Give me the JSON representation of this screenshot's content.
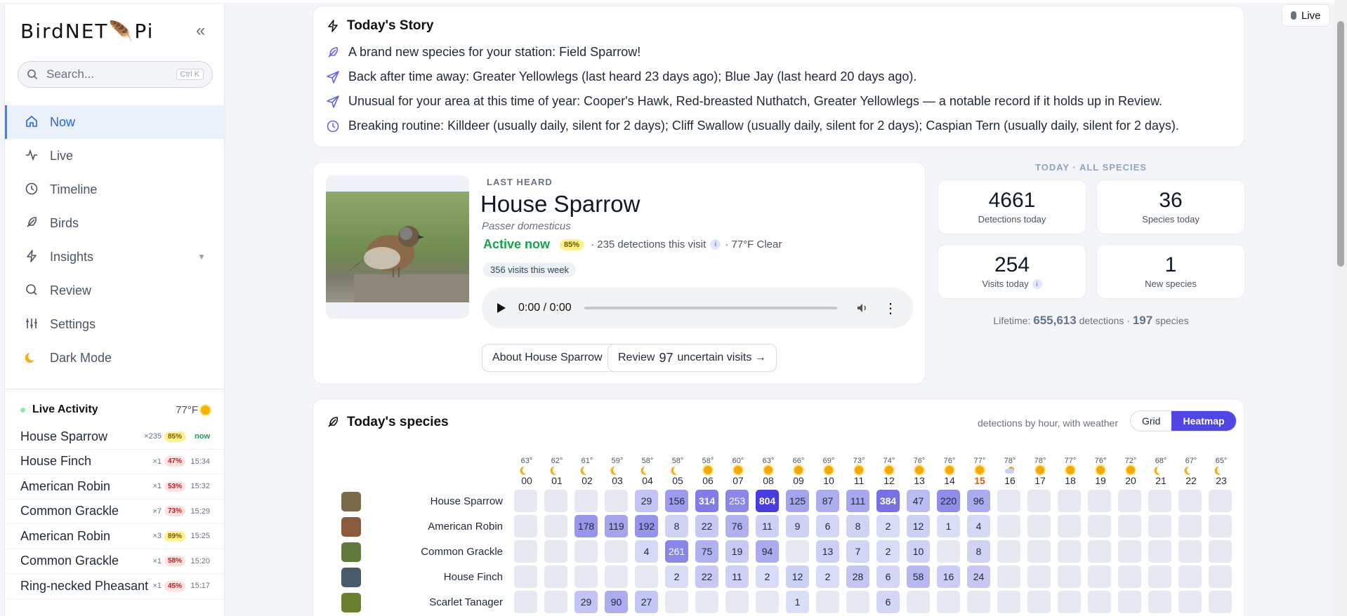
{
  "brand": {
    "left": "BirdNET",
    "right": "Pi"
  },
  "search": {
    "placeholder": "Search...",
    "shortcut": "Ctrl K"
  },
  "nav": [
    {
      "label": "Now",
      "icon": "home-icon",
      "active": true
    },
    {
      "label": "Live",
      "icon": "pulse-icon"
    },
    {
      "label": "Timeline",
      "icon": "clock-icon"
    },
    {
      "label": "Birds",
      "icon": "feather-icon"
    },
    {
      "label": "Insights",
      "icon": "bolt-icon",
      "caret": "▼"
    },
    {
      "label": "Review",
      "icon": "search-icon"
    },
    {
      "label": "Settings",
      "icon": "sliders-icon"
    },
    {
      "label": "Dark Mode",
      "icon": "moon-icon"
    }
  ],
  "live_activity": {
    "title": "Live Activity",
    "temp": "77°F",
    "items": [
      {
        "name": "House Sparrow",
        "count": "×235",
        "conf": "85%",
        "conf_color": "#fef08a",
        "conf_text": "#7a5d00",
        "time": "now"
      },
      {
        "name": "House Finch",
        "count": "×1",
        "conf": "47%",
        "conf_color": "#fee2e2",
        "conf_text": "#b91c1c",
        "time": "15:34"
      },
      {
        "name": "American Robin",
        "count": "×1",
        "conf": "53%",
        "conf_color": "#fee2e2",
        "conf_text": "#b91c1c",
        "time": "15:32"
      },
      {
        "name": "Common Grackle",
        "count": "×7",
        "conf": "73%",
        "conf_color": "#fee2e2",
        "conf_text": "#b91c1c",
        "time": "15:29"
      },
      {
        "name": "American Robin",
        "count": "×3",
        "conf": "89%",
        "conf_color": "#fef08a",
        "conf_text": "#7a5d00",
        "time": "15:25"
      },
      {
        "name": "Common Grackle",
        "count": "×1",
        "conf": "58%",
        "conf_color": "#fee2e2",
        "conf_text": "#b91c1c",
        "time": "15:20"
      },
      {
        "name": "Ring-necked Pheasant",
        "count": "×1",
        "conf": "45%",
        "conf_color": "#fee2e2",
        "conf_text": "#b91c1c",
        "time": "15:17"
      }
    ]
  },
  "story": {
    "title": "Today's Story",
    "lines": [
      {
        "icon": "feather-icon",
        "text": "A brand new species for your station: Field Sparrow!"
      },
      {
        "icon": "send-icon",
        "text": "Back after time away: Greater Yellowlegs (last heard 23 days ago); Blue Jay (last heard 20 days ago)."
      },
      {
        "icon": "send-icon",
        "text": "Unusual for your area at this time of year: Cooper's Hawk, Red-breasted Nuthatch, Greater Yellowlegs — a notable record if it holds up in Review."
      },
      {
        "icon": "clock-icon",
        "text": "Breaking routine: Killdeer (usually daily, silent for 2 days); Cliff Swallow (usually daily, silent for 2 days); Caspian Tern (usually daily, silent for 2 days)."
      }
    ]
  },
  "last_heard": {
    "label": "LAST HEARD",
    "name": "House Sparrow",
    "scientific": "Passer domesticus",
    "status": "Active now",
    "confidence": "85%",
    "detections": "· 235 detections this visit",
    "weather": "· 77°F Clear",
    "visits": "356 visits this week",
    "audio_time": "0:00 / 0:00",
    "about_button": "About House Sparrow →",
    "review_prefix": "Review",
    "review_count": "97",
    "review_suffix": "uncertain visits →"
  },
  "today": {
    "label": "TODAY · ALL SPECIES",
    "stats": [
      {
        "value": "4661",
        "label": "Detections today"
      },
      {
        "value": "36",
        "label": "Species today"
      },
      {
        "value": "254",
        "label": "Visits today",
        "info": true
      },
      {
        "value": "1",
        "label": "New species"
      }
    ],
    "lifetime_prefix": "Lifetime:",
    "lifetime_detections": "655,613",
    "lifetime_mid": "detections ·",
    "lifetime_species": "197",
    "lifetime_suffix": "species"
  },
  "species_card": {
    "title": "Today's species",
    "subtitle": "detections by hour, with weather",
    "toggle": [
      "Grid",
      "Heatmap"
    ],
    "active_toggle": "Heatmap",
    "current_hour": "15",
    "hours": [
      {
        "h": "00",
        "t": "63°",
        "w": "moon"
      },
      {
        "h": "01",
        "t": "62°",
        "w": "moon"
      },
      {
        "h": "02",
        "t": "61°",
        "w": "moon"
      },
      {
        "h": "03",
        "t": "59°",
        "w": "moon"
      },
      {
        "h": "04",
        "t": "58°",
        "w": "moon"
      },
      {
        "h": "05",
        "t": "58°",
        "w": "moon"
      },
      {
        "h": "06",
        "t": "58°",
        "w": "sun"
      },
      {
        "h": "07",
        "t": "60°",
        "w": "sun"
      },
      {
        "h": "08",
        "t": "63°",
        "w": "sun"
      },
      {
        "h": "09",
        "t": "66°",
        "w": "sun"
      },
      {
        "h": "10",
        "t": "69°",
        "w": "sun"
      },
      {
        "h": "11",
        "t": "73°",
        "w": "sun"
      },
      {
        "h": "12",
        "t": "74°",
        "w": "sun"
      },
      {
        "h": "13",
        "t": "76°",
        "w": "sun"
      },
      {
        "h": "14",
        "t": "76°",
        "w": "sun"
      },
      {
        "h": "15",
        "t": "77°",
        "w": "sun"
      },
      {
        "h": "16",
        "t": "78°",
        "w": "cloud"
      },
      {
        "h": "17",
        "t": "78°",
        "w": "sun"
      },
      {
        "h": "18",
        "t": "77°",
        "w": "sun"
      },
      {
        "h": "19",
        "t": "76°",
        "w": "sun"
      },
      {
        "h": "20",
        "t": "72°",
        "w": "sun"
      },
      {
        "h": "21",
        "t": "68°",
        "w": "moon"
      },
      {
        "h": "22",
        "t": "67°",
        "w": "moon"
      },
      {
        "h": "23",
        "t": "65°",
        "w": "moon"
      }
    ],
    "rows": [
      {
        "name": "House Sparrow",
        "thumb": "#7b6a4a",
        "values": [
          "",
          "",
          "",
          "",
          "29",
          "156",
          "314",
          "253",
          "804",
          "125",
          "87",
          "111",
          "384",
          "47",
          "220",
          "96",
          "",
          "",
          "",
          "",
          "",
          "",
          "",
          ""
        ]
      },
      {
        "name": "American Robin",
        "thumb": "#8a5a3c",
        "values": [
          "",
          "",
          "178",
          "119",
          "192",
          "8",
          "22",
          "76",
          "11",
          "9",
          "6",
          "8",
          "2",
          "12",
          "1",
          "4",
          "",
          "",
          "",
          "",
          "",
          "",
          "",
          ""
        ]
      },
      {
        "name": "Common Grackle",
        "thumb": "#5f7a3a",
        "values": [
          "",
          "",
          "",
          "",
          "4",
          "261",
          "75",
          "19",
          "94",
          "",
          "13",
          "7",
          "2",
          "10",
          "",
          "8",
          "",
          "",
          "",
          "",
          "",
          "",
          "",
          ""
        ]
      },
      {
        "name": "House Finch",
        "thumb": "#4a5a6a",
        "values": [
          "",
          "",
          "",
          "",
          "",
          "2",
          "22",
          "11",
          "2",
          "12",
          "2",
          "28",
          "6",
          "58",
          "16",
          "24",
          "",
          "",
          "",
          "",
          "",
          "",
          "",
          ""
        ]
      },
      {
        "name": "Scarlet Tanager",
        "thumb": "#6b7f2e",
        "values": [
          "",
          "",
          "29",
          "90",
          "27",
          "",
          "",
          "",
          "",
          "1",
          "",
          "",
          "6",
          "",
          "",
          "",
          "",
          "",
          "",
          "",
          "",
          "",
          "",
          ""
        ]
      }
    ]
  },
  "live_pill": "Live"
}
